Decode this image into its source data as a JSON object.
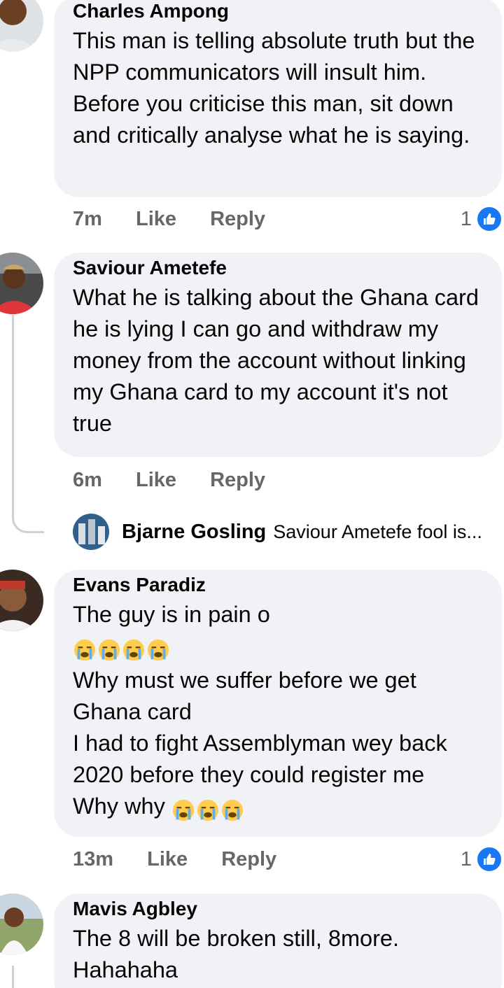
{
  "comments": [
    {
      "author": "Charles Ampong",
      "text": "This man is telling absolute truth but the NPP communicators will insult him. Before you criticise this man, sit down and critically analyse what he is saying.",
      "time": "7m",
      "like_label": "Like",
      "reply_label": "Reply",
      "reaction_count": "1"
    },
    {
      "author": "Saviour Ametefe",
      "text": "What he is talking about the Ghana card he is lying I can go and withdraw my money from the account without linking my Ghana card to my account it's not true",
      "time": "6m",
      "like_label": "Like",
      "reply_label": "Reply"
    },
    {
      "author": "Evans Paradiz",
      "text_line1": "The guy is in pain o",
      "text_line2": "Why must we suffer before we get Ghana card",
      "text_line3": "I had to fight Assemblyman wey back 2020 before they could register me",
      "text_line4": "Why why",
      "time": "13m",
      "like_label": "Like",
      "reply_label": "Reply",
      "reaction_count": "1"
    },
    {
      "author": "Mavis Agbley",
      "text": "The 8 will be broken still, 8more. Hahahaha"
    }
  ],
  "reply_preview": {
    "author": "Bjarne Gosling",
    "text": "Saviour Ametefe fool is..."
  },
  "colors": {
    "bubble": "#f0f2f5",
    "meta_text": "#65676b",
    "like_blue": "#1877f2"
  },
  "icons": {
    "reaction": "like-reaction-icon",
    "emoji": "loudly-crying-face-emoji"
  }
}
